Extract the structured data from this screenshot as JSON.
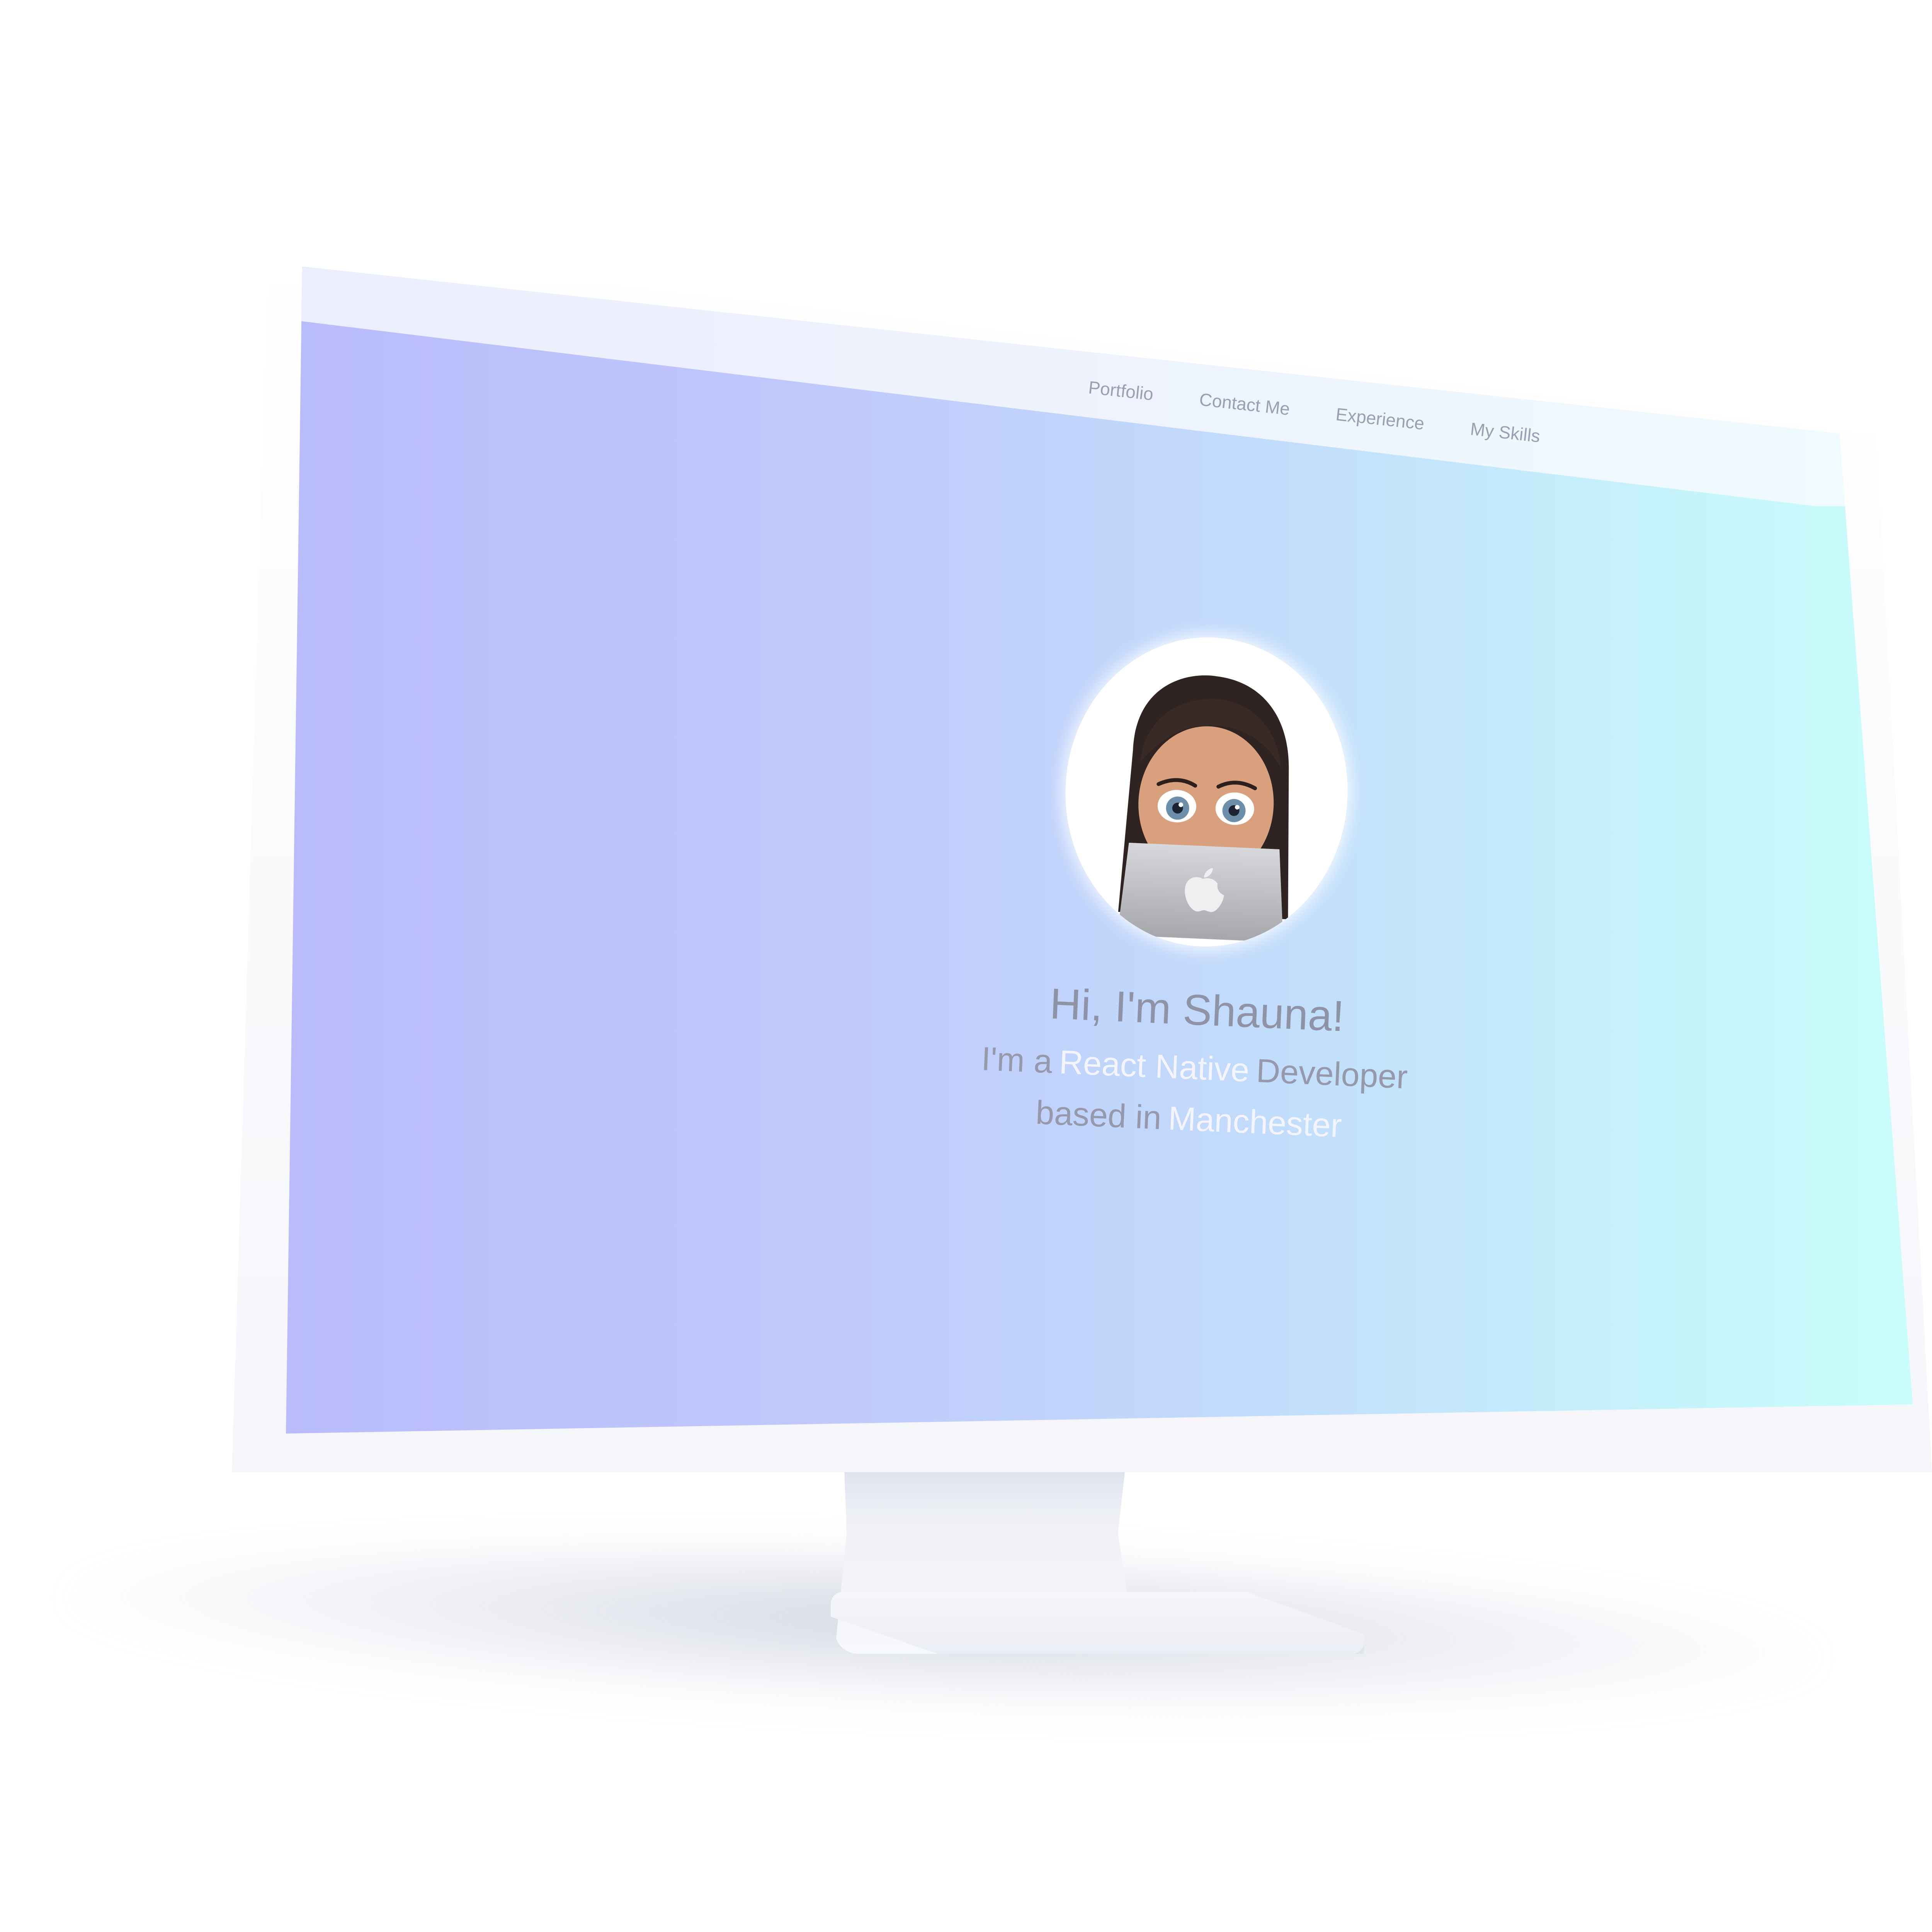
{
  "nav": {
    "items": [
      {
        "label": "Portfolio"
      },
      {
        "label": "Contact Me"
      },
      {
        "label": "Experience"
      },
      {
        "label": "My Skills"
      }
    ]
  },
  "hero": {
    "greeting": "Hi, I'm Shauna!",
    "line1_prefix": "I'm a",
    "line1_accent": "React Native",
    "line1_suffix": "Developer",
    "line2_prefix": "based in",
    "line2_accent": "Manchester",
    "avatar_icon": "memoji-avatar-with-laptop"
  },
  "colors": {
    "gradient_start": "#b9bbfb",
    "gradient_end": "#c9fdfb",
    "nav_text": "#9a9fb2",
    "accent_text": "#f4f5fc"
  }
}
